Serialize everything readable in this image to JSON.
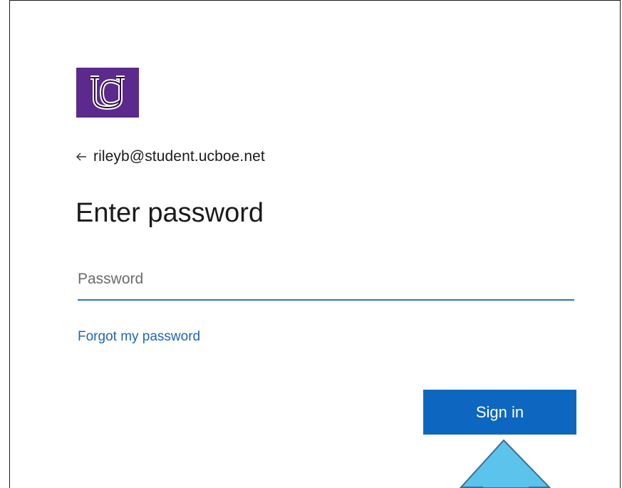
{
  "account": {
    "identity": "rileyb@student.ucboe.net",
    "back_icon": "arrow-left-icon"
  },
  "form": {
    "title": "Enter password",
    "password_placeholder": "Password",
    "password_value": "",
    "forgot_link": "Forgot my password",
    "submit_label": "Sign in"
  },
  "branding": {
    "logo_icon": "uc-monogram-logo",
    "logo_color": "#5b2a8c"
  },
  "annotation": {
    "icon": "up-arrow-callout-icon",
    "color": "#5bc3ec"
  },
  "colors": {
    "accent": "#0d67c0",
    "link": "#1f66b8",
    "input_underline": "#2f72c4"
  }
}
